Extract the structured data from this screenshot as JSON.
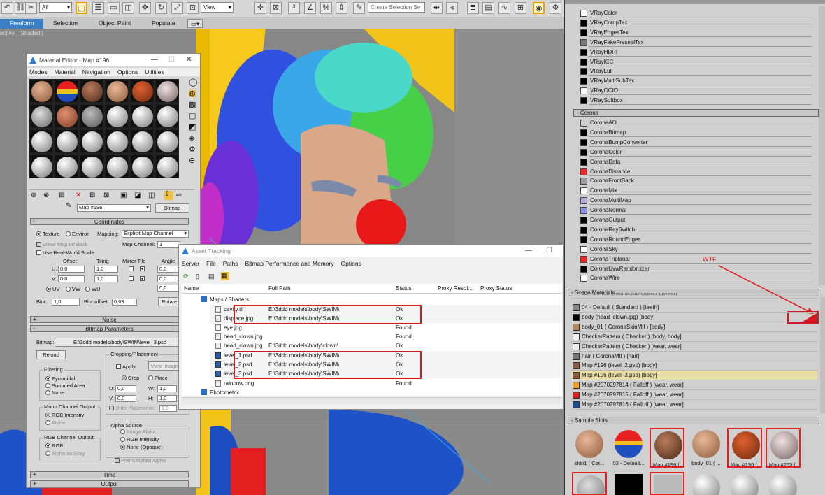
{
  "toolbar": {
    "filter_select": "All",
    "refcoord_select": "View",
    "selection_set": "Create Selection Se"
  },
  "ribbon": {
    "tabs": [
      "Freeform",
      "Selection",
      "Object Paint",
      "Populate"
    ]
  },
  "viewport": {
    "label": "ective ] [Shaded ]"
  },
  "material_editor": {
    "title": "Material Editor - Map #196",
    "menu": [
      "Modes",
      "Material",
      "Navigation",
      "Options",
      "Utilities"
    ],
    "map_name": "Map #196",
    "map_type": "Bitmap",
    "coordinates": {
      "header": "Coordinates",
      "texture_label": "Texture",
      "environ_label": "Environ",
      "mapping_label": "Mapping:",
      "mapping_value": "Explicit Map Channel",
      "show_map_label": "Show Map on Back",
      "map_channel_label": "Map Channel:",
      "map_channel_value": "1",
      "real_world_label": "Use Real-World Scale",
      "offset_label": "Offset",
      "tiling_label": "Tiling",
      "mirror_tile_label": "Mirror Tile",
      "angle_label": "Angle",
      "u_label": "U:",
      "v_label": "V:",
      "u_offset": "0,0",
      "v_offset": "0,0",
      "u_tiling": "1,0",
      "v_tiling": "1,0",
      "u_angle": "0,0",
      "v_angle": "0,0",
      "w_angle": "0,0",
      "uv_label": "UV",
      "vw_label": "VW",
      "wu_label": "WU",
      "blur_label": "Blur:",
      "blur_value": "1,0",
      "blur_offset_label": "Blur offset:",
      "blur_offset_value": "0,03",
      "rotate_label": "Rotate"
    },
    "noise_header": "Noise",
    "bitmap_params_header": "Bitmap Parameters",
    "bitmap_label": "Bitmap:",
    "bitmap_path": "E:\\3ddd models\\body\\SWIM\\level_3.psd",
    "reload_label": "Reload",
    "cropping_title": "Cropping/Placement",
    "apply_label": "Apply",
    "view_image_label": "View Image",
    "crop_label": "Crop",
    "place_label": "Place",
    "crop_u": "0,0",
    "crop_v": "0,0",
    "crop_w": "1,0",
    "crop_h": "1,0",
    "jitter_label": "Jitter Placement:",
    "jitter_value": "1,0",
    "filtering_title": "Filtering",
    "filtering_options": [
      "Pyramidal",
      "Summed Area",
      "None"
    ],
    "mono_title": "Mono Channel Output:",
    "mono_options": [
      "RGB Intensity",
      "Alpha"
    ],
    "rgb_title": "RGB Channel Output:",
    "rgb_options": [
      "RGB",
      "Alpha as Gray"
    ],
    "alpha_title": "Alpha Source",
    "alpha_options": [
      "Image Alpha",
      "RGB Intensity",
      "None (Opaque)"
    ],
    "premult_label": "Premultiplied Alpha",
    "time_header": "Time",
    "output_header": "Output"
  },
  "asset_tracking": {
    "title": "Asset Tracking",
    "menu": [
      "Server",
      "File",
      "Paths",
      "Bitmap Performance and Memory",
      "Options"
    ],
    "columns": [
      "Name",
      "Full Path",
      "Status",
      "Proxy Resol...",
      "Proxy Status"
    ],
    "group": "Maps / Shaders",
    "rows": [
      {
        "name": "cavity.tif",
        "path": "E:\\3ddd models\\body\\SWIM\\",
        "status": "Ok"
      },
      {
        "name": "displace.jpg",
        "path": "E:\\3ddd models\\body\\SWIM\\",
        "status": "Ok"
      },
      {
        "name": "eye.jpg",
        "path": "",
        "status": "Found"
      },
      {
        "name": "head_clown.jpg",
        "path": "",
        "status": "Found"
      },
      {
        "name": "head_clown.jpg",
        "path": "E:\\3ddd models\\body\\clown\\",
        "status": "Ok"
      },
      {
        "name": "level_1.psd",
        "path": "E:\\3ddd models\\body\\SWIM\\",
        "status": "Ok"
      },
      {
        "name": "level_2.psd",
        "path": "E:\\3ddd models\\body\\SWIM\\",
        "status": "Ok"
      },
      {
        "name": "level_3.psd",
        "path": "E:\\3ddd models\\body\\SWIM\\",
        "status": "Ok"
      },
      {
        "name": "rainbow.png",
        "path": "",
        "status": "Found"
      }
    ],
    "photometric": "Photometric"
  },
  "browser": {
    "vray_items": [
      {
        "name": "VRayColor",
        "color": "#ffffff"
      },
      {
        "name": "VRayCompTex",
        "color": "#000000"
      },
      {
        "name": "VRayEdgesTex",
        "color": "#000000"
      },
      {
        "name": "VRayFakeFresnelTex",
        "color": "#7a7a7a"
      },
      {
        "name": "VRayHDRI",
        "color": "#000000"
      },
      {
        "name": "VRayICC",
        "color": "#000000"
      },
      {
        "name": "VRayLut",
        "color": "#000000"
      },
      {
        "name": "VRayMultiSubTex",
        "color": "#000000"
      },
      {
        "name": "VRayOCIO",
        "color": "#ffffff"
      },
      {
        "name": "VRaySoftbox",
        "color": "#000000"
      }
    ],
    "corona_header": "- Corona",
    "corona_items": [
      {
        "name": "CoronaAO",
        "color": "#cfcfcf"
      },
      {
        "name": "CoronaBitmap",
        "color": "#000000"
      },
      {
        "name": "CoronaBumpConverter",
        "color": "#000000"
      },
      {
        "name": "CoronaColor",
        "color": "#000000"
      },
      {
        "name": "CoronaData",
        "color": "#000000"
      },
      {
        "name": "CoronaDistance",
        "color": "#ff2020"
      },
      {
        "name": "CoronaFrontBack",
        "color": "#9aa0a0"
      },
      {
        "name": "CoronaMix",
        "color": "#ffffff"
      },
      {
        "name": "CoronaMultiMap",
        "color": "#b0b0e0"
      },
      {
        "name": "CoronaNormal",
        "color": "#9090f0"
      },
      {
        "name": "CoronaOutput",
        "color": "#000000"
      },
      {
        "name": "CoronaRaySwitch",
        "color": "#000000"
      },
      {
        "name": "CoronaRoundEdges",
        "color": "#000000"
      },
      {
        "name": "CoronaSky",
        "color": "#ffffff"
      },
      {
        "name": "CoronaTriplanar",
        "color": "#ff2020"
      },
      {
        "name": "CoronaUvwRandomizer",
        "color": "#000000"
      },
      {
        "name": "CoronaWire",
        "color": "#ffffff"
      }
    ],
    "scene_header": "- Scene Materials",
    "scene_items": [
      {
        "name": "04 - Default  ( Standard ) [teeth]",
        "color": "#888888"
      },
      {
        "name": "body (head_clown.jpg) [body]",
        "color": "#000000"
      },
      {
        "name": "body_01  ( CoronaSkinMtl ) [body]",
        "color": "#b5865c"
      },
      {
        "name": "CheckerPattern  ( Checker ) [body, body]",
        "color": "#f2f2f2"
      },
      {
        "name": "CheckerPattern  ( Checker ) [wear, wear]",
        "color": "#f2f2f2"
      },
      {
        "name": "hair  ( CoronaMtl ) [hair]",
        "color": "#777777"
      },
      {
        "name": "Map #196 (level_2.psd) [body]",
        "color": "#8a5a40"
      },
      {
        "name": "Map #196 (level_3.psd) [body]",
        "color": "#8a5a40"
      },
      {
        "name": "Map #2070297814  ( Falloff ) [wear, wear]",
        "color": "#f2a020"
      },
      {
        "name": "Map #2070297815  ( Falloff ) [wear, wear]",
        "color": "#d82020"
      },
      {
        "name": "Map #2070297816  ( Falloff ) [wear, wear]",
        "color": "#1a4aa0"
      }
    ],
    "annotation": "WTF",
    "slots_header": "- Sample Slots",
    "slots": [
      {
        "caption": "skin1  ( Cor..."
      },
      {
        "caption": "02 - Default..."
      },
      {
        "caption": "Map #196 (..."
      },
      {
        "caption": "body_01  ( ..."
      },
      {
        "caption": "Map #196 (..."
      },
      {
        "caption": "Map #255 (..."
      }
    ]
  }
}
